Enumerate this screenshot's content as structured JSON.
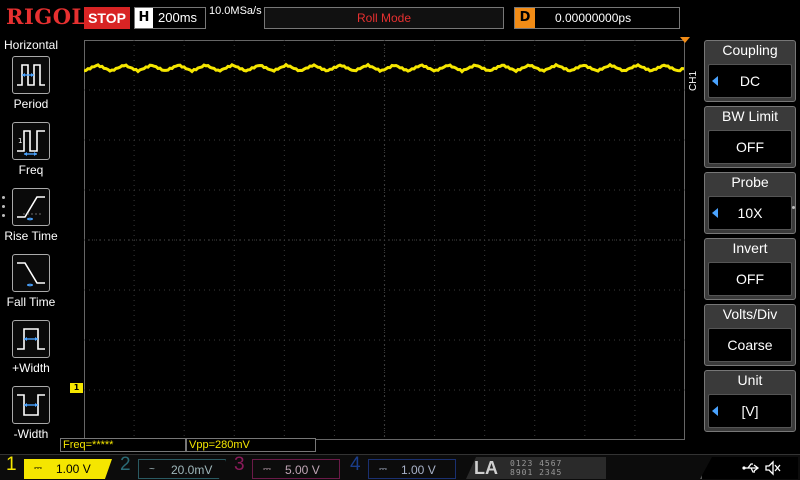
{
  "header": {
    "brand": "RIGOL",
    "run_state": "STOP",
    "timebase_letter": "H",
    "timebase": "200ms",
    "sample_rate": "10.0MSa/s",
    "acquire_mode": "Roll Mode",
    "delay_letter": "D",
    "delay": "0.00000000ps"
  },
  "left_menu": {
    "title": "Horizontal",
    "items": [
      {
        "label": "Period",
        "icon": "period-icon"
      },
      {
        "label": "Freq",
        "icon": "frequency-icon"
      },
      {
        "label": "Rise Time",
        "icon": "rise-time-icon"
      },
      {
        "label": "Fall Time",
        "icon": "fall-time-icon"
      },
      {
        "label": "+Width",
        "icon": "positive-width-icon"
      },
      {
        "label": "-Width",
        "icon": "negative-width-icon"
      }
    ]
  },
  "right_menu": {
    "channel_tab": "CH1",
    "items": [
      {
        "title": "Coupling",
        "value": "DC",
        "selectable": true
      },
      {
        "title": "BW Limit",
        "value": "OFF",
        "selectable": false
      },
      {
        "title": "Probe",
        "value": "10X",
        "selectable": true
      },
      {
        "title": "Invert",
        "value": "OFF",
        "selectable": false
      },
      {
        "title": "Volts/Div",
        "value": "Coarse",
        "selectable": false
      },
      {
        "title": "Unit",
        "value": "[V]",
        "selectable": true
      }
    ]
  },
  "measurements": {
    "freq": "Freq=*****",
    "vpp": "Vpp=280mV"
  },
  "markers": {
    "ch1_ground": "1"
  },
  "channels": [
    {
      "num": "1",
      "coupling": "⎓",
      "scale": "1.00 V",
      "color": "#f5e600"
    },
    {
      "num": "2",
      "coupling": "~",
      "scale": "20.0mV",
      "color": "#2a6a75"
    },
    {
      "num": "3",
      "coupling": "⎓",
      "scale": "5.00 V",
      "color": "#8a1a5a"
    },
    {
      "num": "4",
      "coupling": "⎓",
      "scale": "1.00 V",
      "color": "#1a3d8a"
    }
  ],
  "logic_analyzer": {
    "label": "LA",
    "digits_row1": "0123 4567",
    "digits_row2": "8901 2345"
  },
  "colors": {
    "trace": "#f5e600",
    "grid": "#3a3a3a",
    "accent": "#f28c16",
    "brand": "#e63030"
  }
}
